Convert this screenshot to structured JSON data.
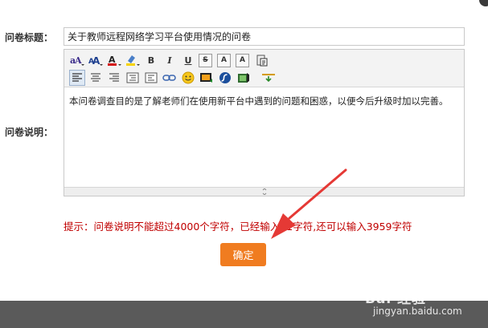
{
  "form": {
    "title_label": "问卷标题：",
    "title_value": "关于教师远程网络学习平台使用情况的问卷",
    "desc_label": "问卷说明："
  },
  "editor": {
    "toolbar_row1_icons": [
      "font-family-icon",
      "font-size-icon",
      "font-color-icon",
      "highlight-color-icon",
      "bold-icon",
      "italic-icon",
      "underline-icon",
      "strikethrough-icon",
      "superscript-icon",
      "subscript-icon",
      "paste-text-icon"
    ],
    "toolbar_row2_icons": [
      "align-left-icon",
      "align-center-icon",
      "align-right-icon",
      "indent-icon",
      "outdent-icon",
      "link-icon",
      "emoticon-icon",
      "image-icon",
      "flash-icon",
      "media-icon",
      "insert-icon"
    ],
    "toolbar_text": {
      "bold": "B",
      "italic": "I",
      "underline": "U",
      "strike": "S",
      "sup": "A",
      "sub": "A"
    },
    "content": "本问卷调查目的是了解老师们在使用新平台中遇到的问题和困惑，以便今后升级时加以完善。"
  },
  "hint": {
    "text": "提示：问卷说明不能超过4000个字符，已经输入41字符,还可以输入3959字符"
  },
  "buttons": {
    "confirm_label": "确定"
  },
  "watermark": {
    "brand": "Bai 经验",
    "url": "jingyan.baidu.com"
  },
  "colors": {
    "hint": "#c00000",
    "confirm_button": "#f07c20",
    "arrow": "#e53935",
    "footer": "#5a5a5a"
  }
}
